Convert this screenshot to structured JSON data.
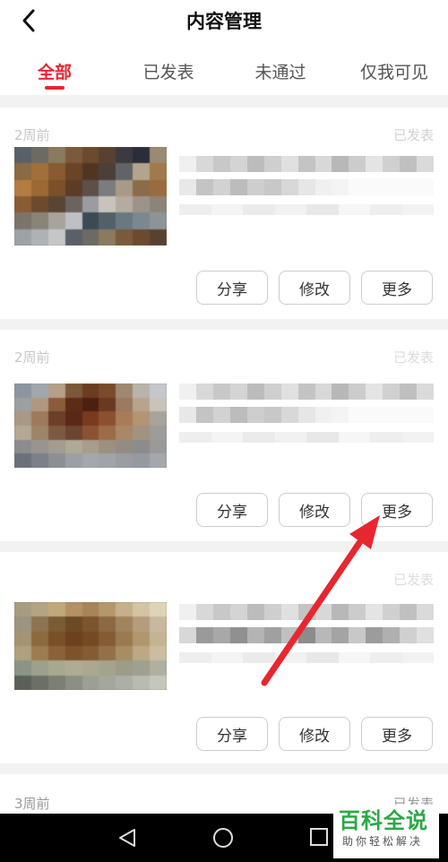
{
  "header": {
    "title": "内容管理",
    "back_icon": "chevron-left-icon"
  },
  "tabs": [
    {
      "label": "全部",
      "active": true
    },
    {
      "label": "已发表",
      "active": false
    },
    {
      "label": "未通过",
      "active": false
    },
    {
      "label": "仅我可见",
      "active": false
    }
  ],
  "cards": [
    {
      "time": "2周前",
      "status": "已发表",
      "buttons": [
        "分享",
        "修改",
        "更多"
      ]
    },
    {
      "time": "2周前",
      "status": "已发表",
      "buttons": [
        "分享",
        "修改",
        "更多"
      ]
    },
    {
      "time": "",
      "status": "已发表",
      "buttons": [
        "分享",
        "修改",
        "更多"
      ]
    },
    {
      "time": "3周前",
      "status": "已发表",
      "buttons": []
    }
  ],
  "watermark": {
    "title": "百科全说",
    "subtitle": "助你轻松解决",
    "color": "#2da845"
  },
  "colors": {
    "accent": "#e8262f",
    "annotation_arrow": "#e8262f"
  }
}
